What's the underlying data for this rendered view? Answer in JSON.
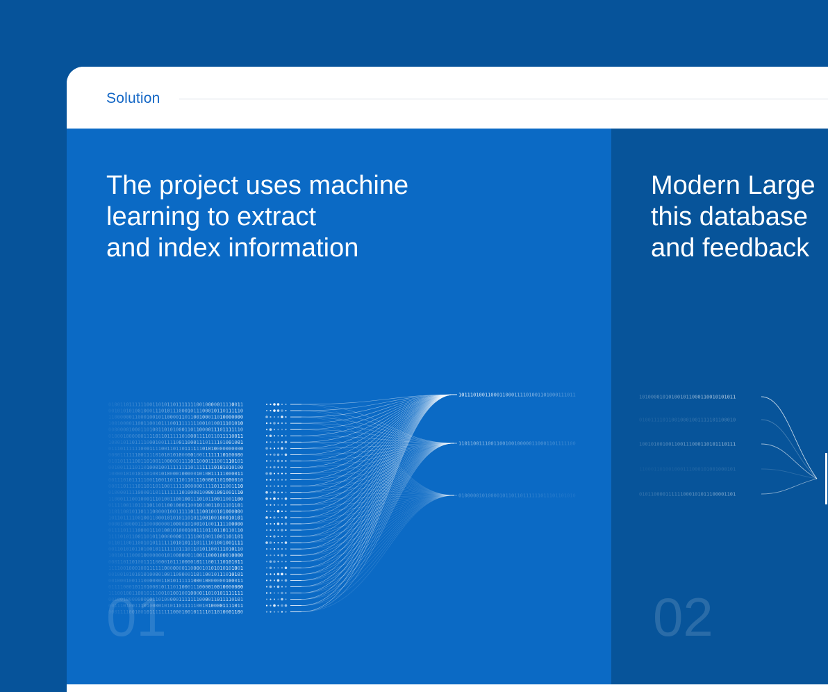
{
  "section": {
    "label": "Solution"
  },
  "panels": [
    {
      "title_lines": [
        "The project uses machine",
        "learning to extract",
        "and index information"
      ],
      "number": "01"
    },
    {
      "title_lines": [
        "Modern Large",
        "this database",
        "and feedback"
      ],
      "number": "02"
    }
  ],
  "colors": {
    "page_background": "#06539A",
    "panel_1": "#0B6AC5",
    "panel_2": "#07549A",
    "accent": "#1467C5"
  }
}
